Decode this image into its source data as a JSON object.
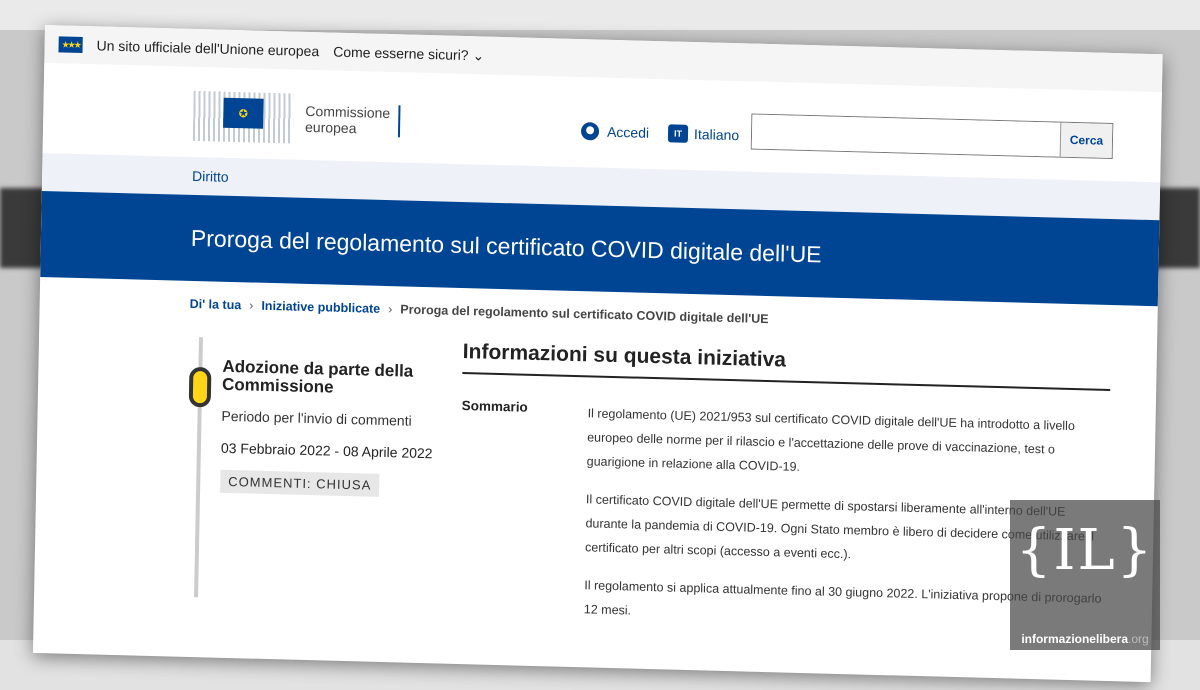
{
  "gov_bar": {
    "official_text": "Un sito ufficiale dell'Unione europea",
    "how_to_know": "Come esserne sicuri?"
  },
  "header": {
    "logo_line1": "Commissione",
    "logo_line2": "europea",
    "login_label": "Accedi",
    "lang_code": "IT",
    "lang_label": "Italiano",
    "search_placeholder": "",
    "search_button": "Cerca"
  },
  "nav": {
    "item": "Diritto"
  },
  "banner": {
    "title": "Proroga del regolamento sul certificato COVID digitale dell'UE"
  },
  "breadcrumb": [
    "Di' la tua",
    "Iniziative pubblicate",
    "Proroga del regolamento sul certificato COVID digitale dell'UE"
  ],
  "breadcrumb_sep": "›",
  "stage": {
    "title": "Adozione da parte della Commissione",
    "period_label": "Periodo per l'invio di commenti",
    "dates": "03 Febbraio 2022 - 08 Aprile 2022",
    "status": "COMMENTI: CHIUSA"
  },
  "info": {
    "title": "Informazioni su questa iniziativa",
    "summary_label": "Sommario",
    "paragraphs": [
      "Il regolamento (UE) 2021/953 sul certificato COVID digitale dell'UE ha introdotto a livello europeo delle norme per il rilascio e l'accettazione delle prove di vaccinazione, test o guarigione in relazione alla COVID-19.",
      "Il certificato COVID digitale dell'UE permette di spostarsi liberamente all'interno dell'UE durante la pandemia di COVID-19. Ogni Stato membro è libero di decidere come utilizzare il certificato per altri scopi (accesso a eventi ecc.).",
      "Il regolamento si applica attualmente fino al 30 giugno 2022. L'iniziativa propone di prorogarlo 12 mesi."
    ]
  },
  "watermark": {
    "logo": "{IL}",
    "name": "informazionelibera",
    "tld": ".org"
  },
  "colors": {
    "eu_blue": "#004494",
    "eu_yellow": "#ffd617"
  }
}
